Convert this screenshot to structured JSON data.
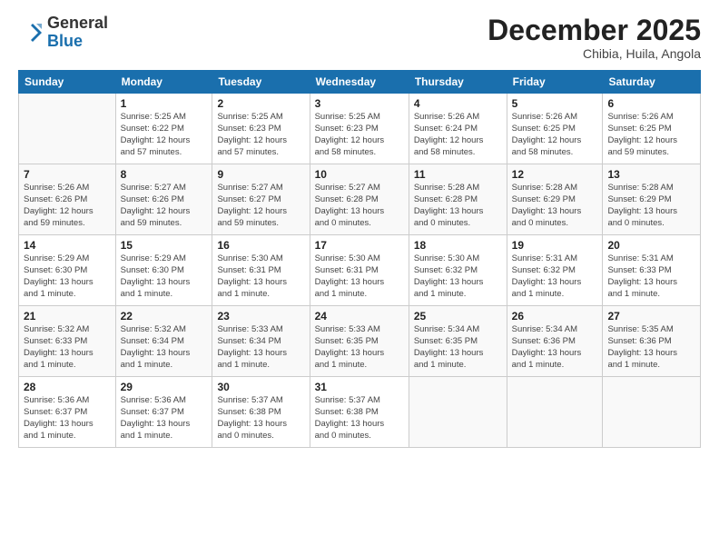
{
  "logo": {
    "general": "General",
    "blue": "Blue"
  },
  "header": {
    "month": "December 2025",
    "location": "Chibia, Huila, Angola"
  },
  "weekdays": [
    "Sunday",
    "Monday",
    "Tuesday",
    "Wednesday",
    "Thursday",
    "Friday",
    "Saturday"
  ],
  "weeks": [
    [
      {
        "day": "",
        "info": ""
      },
      {
        "day": "1",
        "info": "Sunrise: 5:25 AM\nSunset: 6:22 PM\nDaylight: 12 hours\nand 57 minutes."
      },
      {
        "day": "2",
        "info": "Sunrise: 5:25 AM\nSunset: 6:23 PM\nDaylight: 12 hours\nand 57 minutes."
      },
      {
        "day": "3",
        "info": "Sunrise: 5:25 AM\nSunset: 6:23 PM\nDaylight: 12 hours\nand 58 minutes."
      },
      {
        "day": "4",
        "info": "Sunrise: 5:26 AM\nSunset: 6:24 PM\nDaylight: 12 hours\nand 58 minutes."
      },
      {
        "day": "5",
        "info": "Sunrise: 5:26 AM\nSunset: 6:25 PM\nDaylight: 12 hours\nand 58 minutes."
      },
      {
        "day": "6",
        "info": "Sunrise: 5:26 AM\nSunset: 6:25 PM\nDaylight: 12 hours\nand 59 minutes."
      }
    ],
    [
      {
        "day": "7",
        "info": "Sunrise: 5:26 AM\nSunset: 6:26 PM\nDaylight: 12 hours\nand 59 minutes."
      },
      {
        "day": "8",
        "info": "Sunrise: 5:27 AM\nSunset: 6:26 PM\nDaylight: 12 hours\nand 59 minutes."
      },
      {
        "day": "9",
        "info": "Sunrise: 5:27 AM\nSunset: 6:27 PM\nDaylight: 12 hours\nand 59 minutes."
      },
      {
        "day": "10",
        "info": "Sunrise: 5:27 AM\nSunset: 6:28 PM\nDaylight: 13 hours\nand 0 minutes."
      },
      {
        "day": "11",
        "info": "Sunrise: 5:28 AM\nSunset: 6:28 PM\nDaylight: 13 hours\nand 0 minutes."
      },
      {
        "day": "12",
        "info": "Sunrise: 5:28 AM\nSunset: 6:29 PM\nDaylight: 13 hours\nand 0 minutes."
      },
      {
        "day": "13",
        "info": "Sunrise: 5:28 AM\nSunset: 6:29 PM\nDaylight: 13 hours\nand 0 minutes."
      }
    ],
    [
      {
        "day": "14",
        "info": "Sunrise: 5:29 AM\nSunset: 6:30 PM\nDaylight: 13 hours\nand 1 minute."
      },
      {
        "day": "15",
        "info": "Sunrise: 5:29 AM\nSunset: 6:30 PM\nDaylight: 13 hours\nand 1 minute."
      },
      {
        "day": "16",
        "info": "Sunrise: 5:30 AM\nSunset: 6:31 PM\nDaylight: 13 hours\nand 1 minute."
      },
      {
        "day": "17",
        "info": "Sunrise: 5:30 AM\nSunset: 6:31 PM\nDaylight: 13 hours\nand 1 minute."
      },
      {
        "day": "18",
        "info": "Sunrise: 5:30 AM\nSunset: 6:32 PM\nDaylight: 13 hours\nand 1 minute."
      },
      {
        "day": "19",
        "info": "Sunrise: 5:31 AM\nSunset: 6:32 PM\nDaylight: 13 hours\nand 1 minute."
      },
      {
        "day": "20",
        "info": "Sunrise: 5:31 AM\nSunset: 6:33 PM\nDaylight: 13 hours\nand 1 minute."
      }
    ],
    [
      {
        "day": "21",
        "info": "Sunrise: 5:32 AM\nSunset: 6:33 PM\nDaylight: 13 hours\nand 1 minute."
      },
      {
        "day": "22",
        "info": "Sunrise: 5:32 AM\nSunset: 6:34 PM\nDaylight: 13 hours\nand 1 minute."
      },
      {
        "day": "23",
        "info": "Sunrise: 5:33 AM\nSunset: 6:34 PM\nDaylight: 13 hours\nand 1 minute."
      },
      {
        "day": "24",
        "info": "Sunrise: 5:33 AM\nSunset: 6:35 PM\nDaylight: 13 hours\nand 1 minute."
      },
      {
        "day": "25",
        "info": "Sunrise: 5:34 AM\nSunset: 6:35 PM\nDaylight: 13 hours\nand 1 minute."
      },
      {
        "day": "26",
        "info": "Sunrise: 5:34 AM\nSunset: 6:36 PM\nDaylight: 13 hours\nand 1 minute."
      },
      {
        "day": "27",
        "info": "Sunrise: 5:35 AM\nSunset: 6:36 PM\nDaylight: 13 hours\nand 1 minute."
      }
    ],
    [
      {
        "day": "28",
        "info": "Sunrise: 5:36 AM\nSunset: 6:37 PM\nDaylight: 13 hours\nand 1 minute."
      },
      {
        "day": "29",
        "info": "Sunrise: 5:36 AM\nSunset: 6:37 PM\nDaylight: 13 hours\nand 1 minute."
      },
      {
        "day": "30",
        "info": "Sunrise: 5:37 AM\nSunset: 6:38 PM\nDaylight: 13 hours\nand 0 minutes."
      },
      {
        "day": "31",
        "info": "Sunrise: 5:37 AM\nSunset: 6:38 PM\nDaylight: 13 hours\nand 0 minutes."
      },
      {
        "day": "",
        "info": ""
      },
      {
        "day": "",
        "info": ""
      },
      {
        "day": "",
        "info": ""
      }
    ]
  ]
}
